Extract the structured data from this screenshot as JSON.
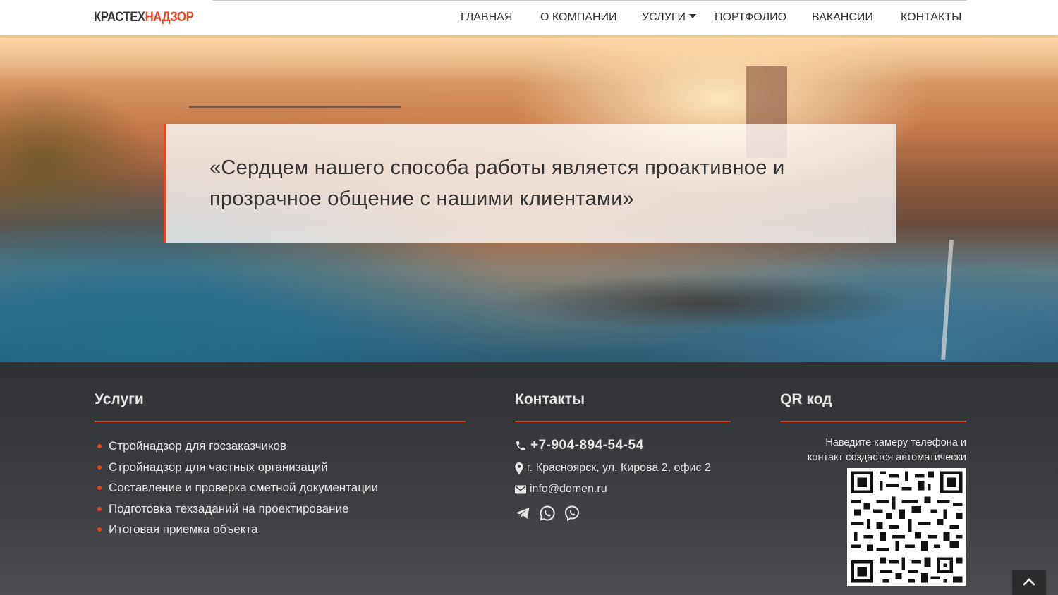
{
  "header": {
    "logo": {
      "part1": "КРАСТЕХ",
      "part2": "НАДЗОР"
    },
    "nav": [
      {
        "label": "ГЛАВНАЯ"
      },
      {
        "label": "О КОМПАНИИ"
      },
      {
        "label": "УСЛУГИ",
        "has_dropdown": true
      },
      {
        "label": "ПОРТФОЛИО"
      },
      {
        "label": "ВАКАНСИИ"
      },
      {
        "label": "КОНТАКТЫ"
      }
    ]
  },
  "hero": {
    "quote": "«Сердцем нашего способа работы является проактивное и прозрачное общение с нашими клиентами»"
  },
  "footer": {
    "services": {
      "title": "Услуги",
      "items": [
        "Стройнадзор для госзаказчиков",
        "Стройнадзор для частных организаций",
        "Составление и проверка сметной документации",
        "Подготовка техзаданий на проектирование",
        "Итоговая приемка объекта"
      ]
    },
    "contacts": {
      "title": "Контакты",
      "phone": "+7-904-894-54-54",
      "address": "г. Красноярск, ул. Кирова 2, офис 2",
      "email": "info@domen.ru",
      "social_icons": [
        "telegram-icon",
        "whatsapp-icon",
        "viber-icon"
      ]
    },
    "qr": {
      "title": "QR код",
      "caption_line1": "Наведите камеру телефона и",
      "caption_line2": "контакт создастся автоматически"
    }
  },
  "colors": {
    "accent": "#e8451f",
    "footer_bg": "#3a3c3f",
    "header_bg": "#ffffff",
    "text_dark": "#333333",
    "text_light": "#e6e6e6"
  }
}
